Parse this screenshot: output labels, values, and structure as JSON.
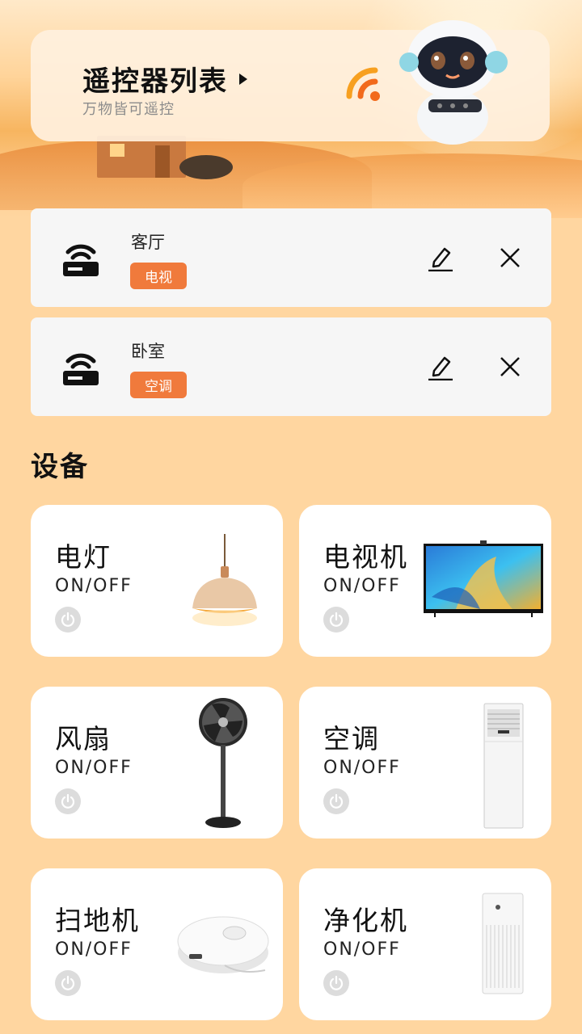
{
  "header": {
    "title": "遥控器列表",
    "subtitle": "万物皆可遥控"
  },
  "remotes": [
    {
      "name": "客厅",
      "tag": "电视"
    },
    {
      "name": "卧室",
      "tag": "空调"
    }
  ],
  "devices_section": {
    "title": "设备",
    "items": [
      {
        "name": "电灯",
        "status": "ON/OFF",
        "image": "pendant-lamp-icon"
      },
      {
        "name": "电视机",
        "status": "ON/OFF",
        "image": "television-icon"
      },
      {
        "name": "风扇",
        "status": "ON/OFF",
        "image": "standing-fan-icon"
      },
      {
        "name": "空调",
        "status": "ON/OFF",
        "image": "air-conditioner-icon"
      },
      {
        "name": "扫地机",
        "status": "ON/OFF",
        "image": "robot-vacuum-icon"
      },
      {
        "name": "净化机",
        "status": "ON/OFF",
        "image": "air-purifier-icon"
      }
    ]
  },
  "colors": {
    "background": "#ffd6a0",
    "tag": "#f07a3c",
    "accent_wifi": "#f26a1b"
  }
}
